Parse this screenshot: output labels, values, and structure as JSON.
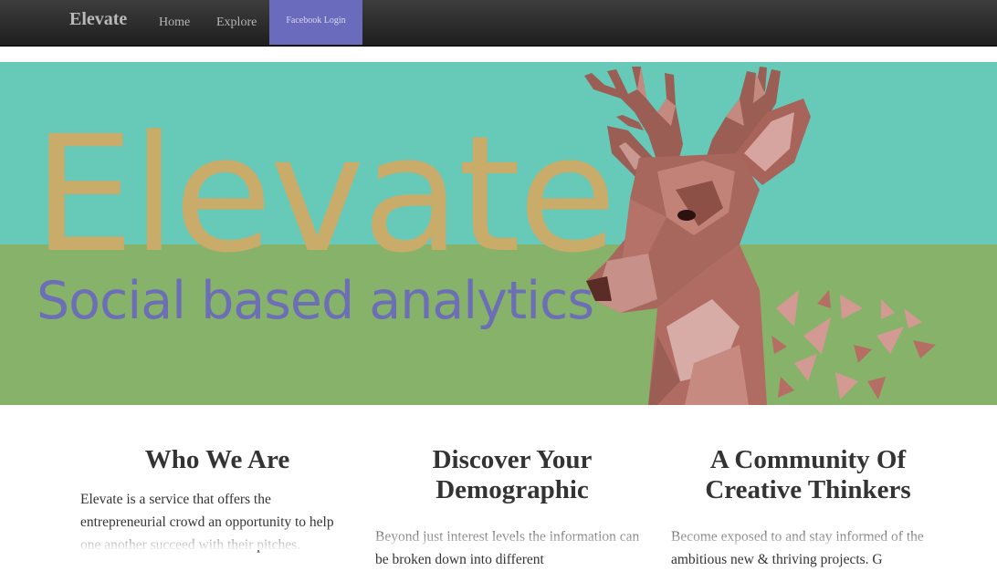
{
  "nav": {
    "brand": "Elevate",
    "links": [
      "Home",
      "Explore"
    ],
    "login_label": "Facebook Login"
  },
  "hero": {
    "title": "Elevate",
    "subtitle": "Social based analytics",
    "image": "low-poly-deer-illustration"
  },
  "features": [
    {
      "title": "Who We Are",
      "text": "Elevate is a service that offers the entrepreneurial crowd an opportunity to help one another succeed with their pitches."
    },
    {
      "title": "Discover Your Demographic",
      "text": "Beyond just interest levels the information can be broken down into different"
    },
    {
      "title": "A Community Of Creative Thinkers",
      "text": "Become exposed to and stay informed of the ambitious new & thriving projects. G"
    }
  ],
  "colors": {
    "nav_bg": "#2a2a2a",
    "login_button": "#6b6bbd",
    "hero_teal": "#67c9b7",
    "hero_green": "#87b269",
    "title_gold": "#c9ab6a",
    "subtitle_purple": "#6c6fb6",
    "deer_brown": "#9a5e54"
  }
}
